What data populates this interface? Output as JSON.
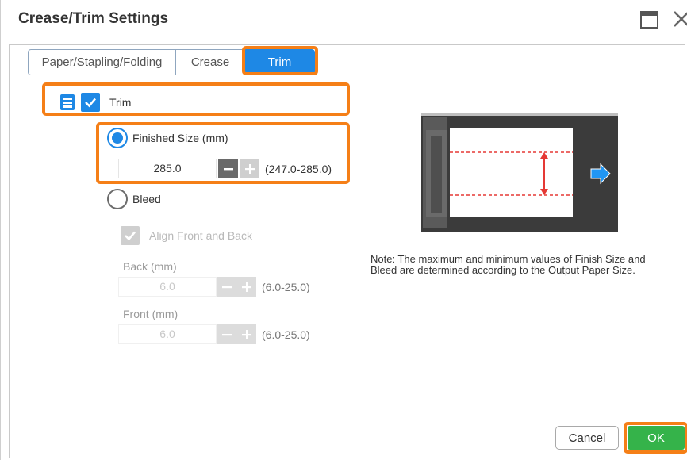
{
  "window": {
    "title": "Crease/Trim Settings",
    "restore_icon": "window-restore-icon",
    "close_icon": "close-icon"
  },
  "tabs": [
    {
      "label": "Paper/Stapling/Folding",
      "selected": false
    },
    {
      "label": "Crease",
      "selected": false
    },
    {
      "label": "Trim",
      "selected": true
    }
  ],
  "trim": {
    "label": "Trim",
    "checked": true,
    "icon": "document-stack-icon"
  },
  "finished_size": {
    "label": "Finished Size (mm)",
    "selected": true,
    "value": "285.0",
    "range": "(247.0-285.0)"
  },
  "bleed": {
    "label": "Bleed",
    "selected": false,
    "align_label": "Align Front and Back",
    "back_label": "Back (mm)",
    "back_value": "6.0",
    "back_range": "(6.0-25.0)",
    "front_label": "Front (mm)",
    "front_value": "6.0",
    "front_range": "(6.0-25.0)"
  },
  "note": "Note: The maximum and minimum values of Finish Size and Bleed are determined according to the Output Paper Size.",
  "buttons": {
    "cancel": "Cancel",
    "ok": "OK"
  },
  "colors": {
    "accent": "#1e88e5",
    "highlight": "#f57f17",
    "ok": "#35b34a",
    "cut_line": "#e53935"
  }
}
